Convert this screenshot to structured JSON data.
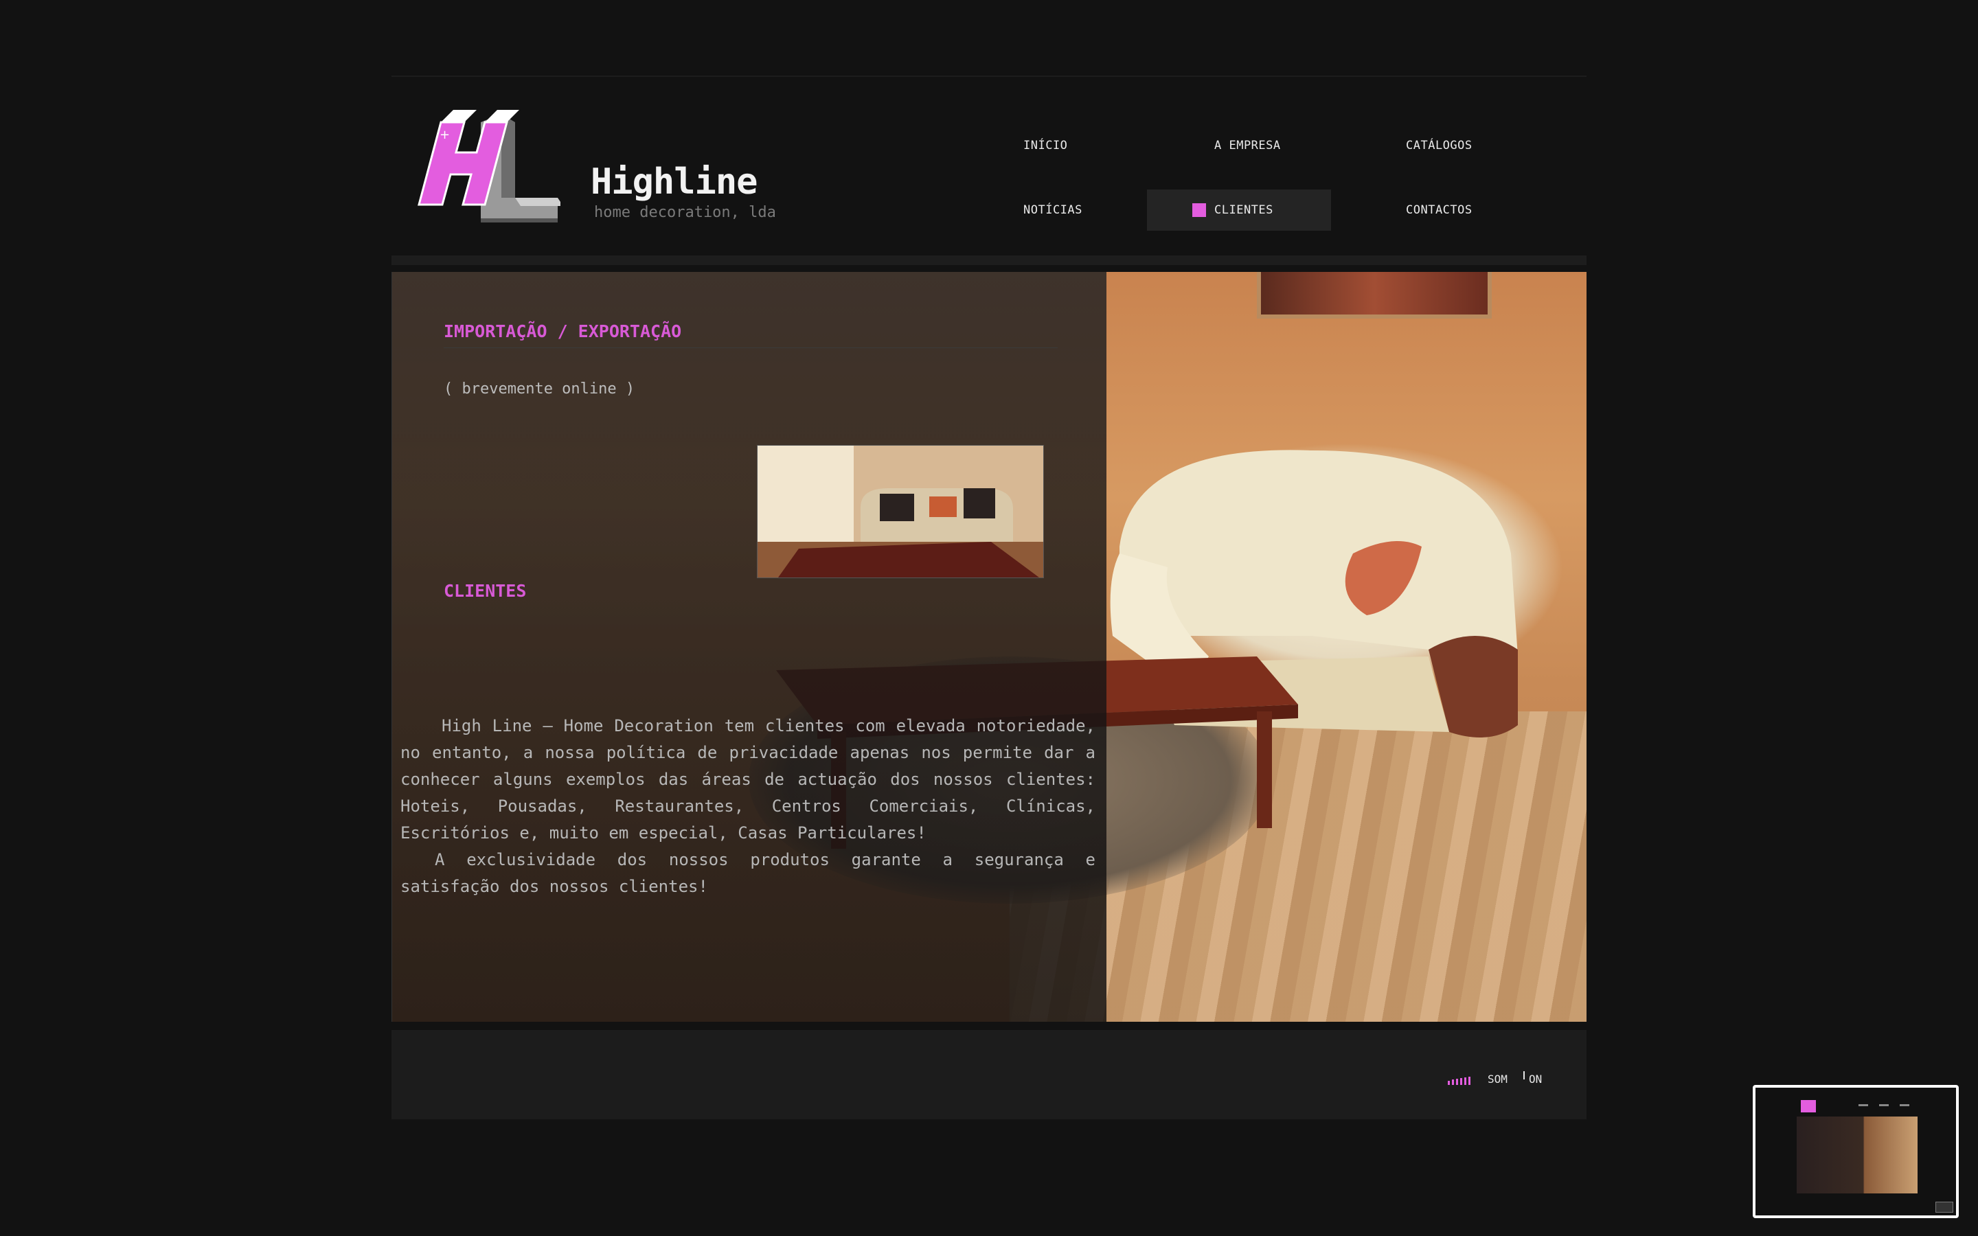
{
  "brand": {
    "name": "Highline",
    "tagline": "home decoration, lda",
    "accent": "#e35ddf"
  },
  "nav": {
    "items": [
      {
        "label": "Início",
        "active": false
      },
      {
        "label": "A Empresa",
        "active": false
      },
      {
        "label": "Catálogos",
        "active": false
      },
      {
        "label": "Notícias",
        "active": false
      },
      {
        "label": "Clientes",
        "active": true
      },
      {
        "label": "Contactos",
        "active": false
      }
    ]
  },
  "content": {
    "section1_title": "Importação / Exportação",
    "section1_text": "( brevemente online )",
    "section2_title": "Clientes",
    "paragraph1": "High Line – Home Decoration tem clientes com elevada notoriedade, no entanto, a nossa política de privacidade apenas nos permite dar a conhecer alguns exemplos das áreas de actuação dos nossos clientes: Hoteis, Pousadas, Restaurantes, Centros Comerciais, Clínicas, Escritórios e, muito em especial, Casas Particulares!",
    "paragraph2": "A exclusividade dos nossos produtos garante a segurança e satisfação dos nossos clientes!"
  },
  "footer": {
    "sound_label": "SOM",
    "sound_state": "ON"
  },
  "icons": [
    "logo-hl-icon",
    "nav-marker-icon",
    "sound-bars-icon"
  ]
}
